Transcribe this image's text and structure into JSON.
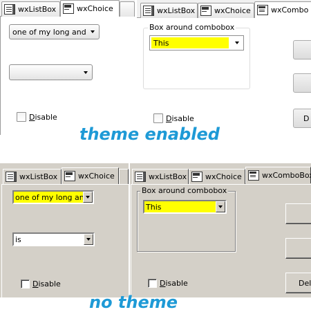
{
  "themed": {
    "left": {
      "tabs": [
        {
          "label": "wxListBox",
          "icon": "listbox-icon"
        },
        {
          "label": "wxChoice",
          "icon": "choice-icon"
        }
      ],
      "choice1": {
        "value": "one of my long and"
      },
      "choice2": {
        "value": ""
      },
      "disable": {
        "label": "Disable",
        "checked": false
      }
    },
    "right": {
      "tabs": [
        {
          "label": "wxListBox",
          "icon": "listbox-icon"
        },
        {
          "label": "wxChoice",
          "icon": "choice-icon"
        },
        {
          "label": "wxCombo",
          "icon": "combobox-icon"
        }
      ],
      "group_label": "Box around combobox",
      "combo": {
        "value": "This",
        "background": "#ffff00"
      },
      "disable": {
        "label": "Disable",
        "checked": false
      },
      "button_partial": "D"
    },
    "caption": "theme enabled"
  },
  "classic": {
    "left": {
      "tabs": [
        {
          "label": "wxListBox",
          "icon": "listbox-icon"
        },
        {
          "label": "wxChoice",
          "icon": "choice-icon"
        }
      ],
      "choice1": {
        "value": "one of my long and",
        "background": "#ffff00"
      },
      "choice2": {
        "value": "is"
      },
      "disable": {
        "label": "Disable",
        "checked": false
      }
    },
    "right": {
      "tabs": [
        {
          "label": "wxListBox",
          "icon": "listbox-icon"
        },
        {
          "label": "wxChoice",
          "icon": "choice-icon"
        },
        {
          "label": "wxComboBox",
          "icon": "combobox-icon"
        }
      ],
      "group_label": "Box around combobox",
      "combo": {
        "value": "This",
        "background": "#ffff00"
      },
      "disable": {
        "label": "Disable",
        "checked": false
      },
      "button_partial": "Del"
    },
    "caption": "no theme"
  },
  "colors": {
    "caption": "#1e9ad6",
    "classic_face": "#d4d0c8",
    "highlight": "#ffff00"
  }
}
